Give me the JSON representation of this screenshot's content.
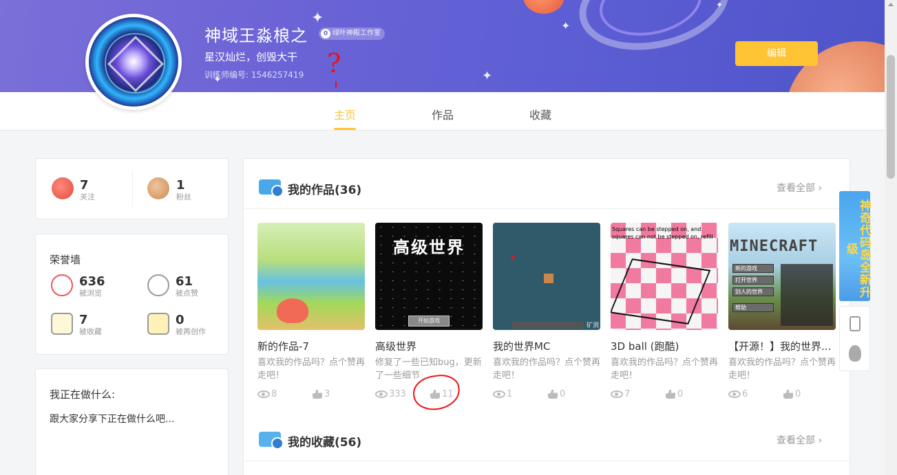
{
  "profile": {
    "name": "神域王淼桹之",
    "studio_badge": "绿叶神殿工作室",
    "badge_count": "0",
    "motto": "星汉灿烂，创毁大干",
    "trainer_id": "训练师编号: 1546257419",
    "edit_label": "编辑"
  },
  "annotation": {
    "question": "?"
  },
  "tabs": [
    {
      "label": "主页",
      "active": true
    },
    {
      "label": "作品",
      "active": false
    },
    {
      "label": "收藏",
      "active": false
    }
  ],
  "follow": {
    "following_count": "7",
    "following_label": "关注",
    "fans_count": "1",
    "fans_label": "粉丝"
  },
  "honor": {
    "title": "荣誉墙",
    "views": {
      "count": "636",
      "label": "被浏览"
    },
    "likes": {
      "count": "61",
      "label": "被点赞"
    },
    "collects": {
      "count": "7",
      "label": "被收藏"
    },
    "recreates": {
      "count": "0",
      "label": "被再创作"
    }
  },
  "doing": {
    "title": "我正在做什么:",
    "text": "跟大家分享下正在做什么吧..."
  },
  "my_works": {
    "title": "我的作品(36)",
    "see_all": "查看全部",
    "items": [
      {
        "title": "新的作品-7",
        "desc": "喜欢我的作品吗？点个赞再走吧！",
        "views": "8",
        "likes": "3"
      },
      {
        "title": "高级世界",
        "desc": "修复了一些已知bug，更新了一些细节",
        "views": "333",
        "likes": "11",
        "thumb_text": "高级世界",
        "thumb_button": "开始游戏"
      },
      {
        "title": "我的世界MC",
        "desc": "喜欢我的作品吗？点个赞再走吧！",
        "views": "1",
        "likes": "0",
        "thumb_text": "矿洞"
      },
      {
        "title": "3D ball (跑酷)",
        "desc": "喜欢我的作品吗？点个赞再走吧！",
        "views": "7",
        "likes": "0",
        "thumb_text": "Squares can be stepped on, and squares can not be stepped on, refill"
      },
      {
        "title": "【开源！】我的世界...",
        "desc": "喜欢我的作品吗？点个赞再走吧！",
        "views": "6",
        "likes": "0",
        "thumb_logo": "MINECRAFT",
        "thumb_menu": [
          "新的游戏",
          "打开世界",
          "别人的世界",
          "帮助"
        ]
      }
    ]
  },
  "my_collections": {
    "title": "我的收藏(56)",
    "see_all": "查看全部"
  },
  "float_banner": {
    "text": "神奇代码岛全新升级"
  }
}
